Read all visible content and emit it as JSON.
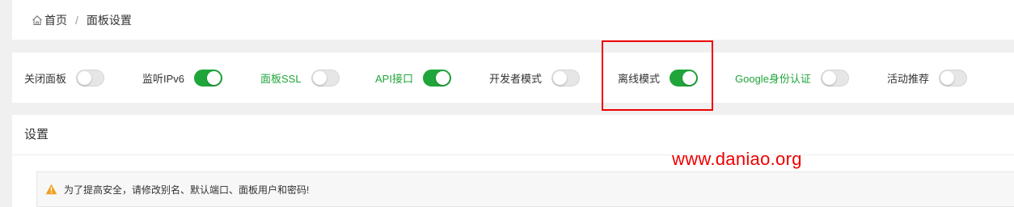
{
  "breadcrumb": {
    "home": "首页",
    "separator": "/",
    "current": "面板设置"
  },
  "toggles": [
    {
      "label": "关闭面板",
      "on": false,
      "label_color": "default"
    },
    {
      "label": "监听IPv6",
      "on": true,
      "label_color": "default"
    },
    {
      "label": "面板SSL",
      "on": false,
      "label_color": "green"
    },
    {
      "label": "API接口",
      "on": true,
      "label_color": "green"
    },
    {
      "label": "开发者模式",
      "on": false,
      "label_color": "default"
    },
    {
      "label": "离线模式",
      "on": true,
      "label_color": "default"
    },
    {
      "label": "Google身份认证",
      "on": false,
      "label_color": "green"
    },
    {
      "label": "活动推荐",
      "on": false,
      "label_color": "default"
    }
  ],
  "settings": {
    "title": "设置",
    "warning": "为了提高安全，请修改别名、默认端口、面板用户和密码!"
  },
  "watermark": "www.daniao.org",
  "colors": {
    "accent": "#20a53a",
    "highlight": "#ee0000",
    "warning_icon": "#f0a020"
  }
}
